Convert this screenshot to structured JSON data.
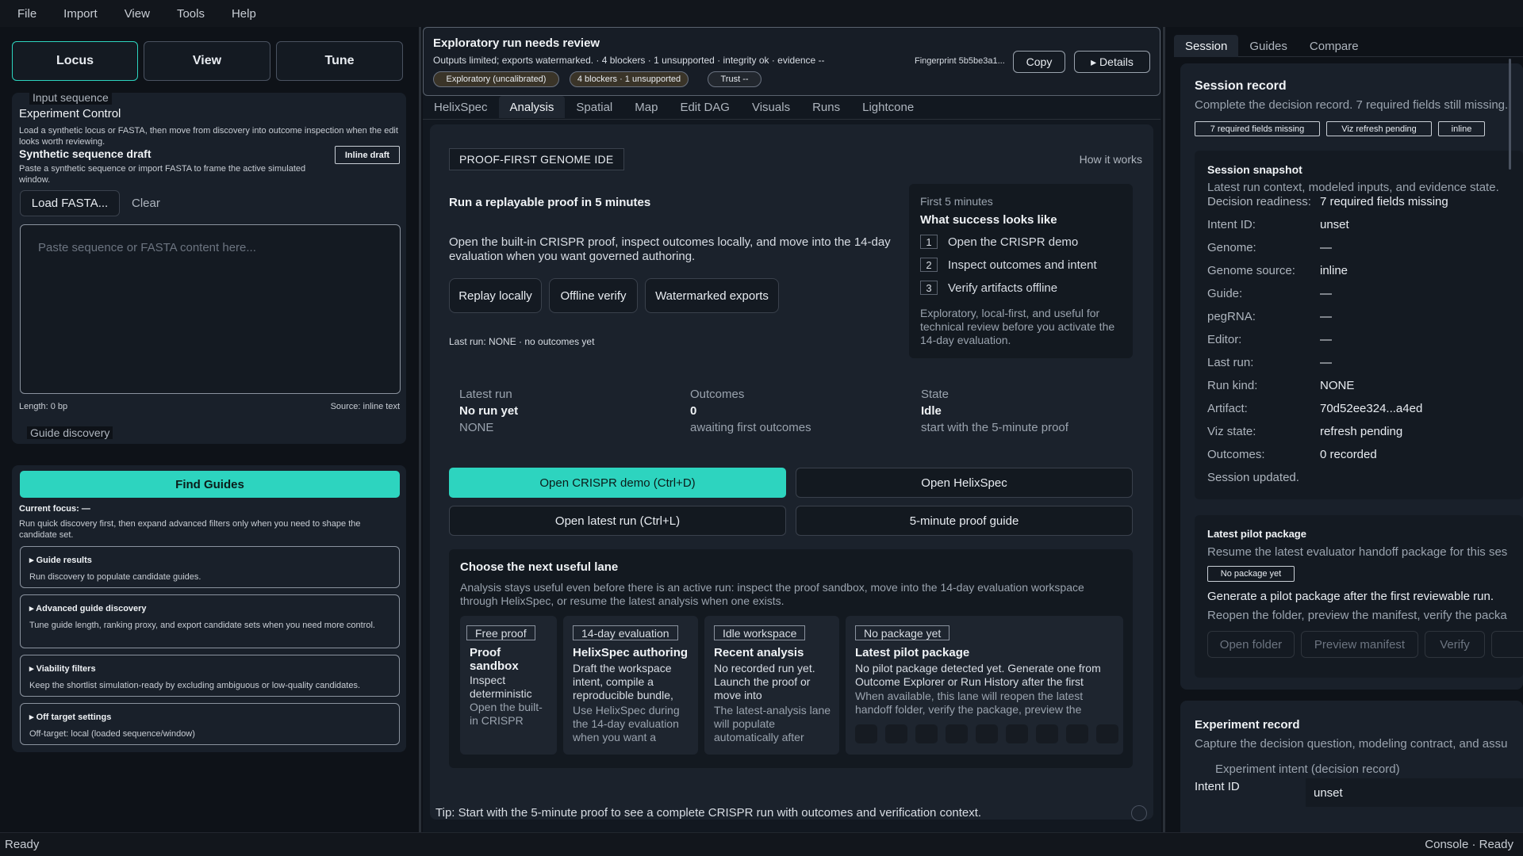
{
  "menu": [
    "File",
    "Import",
    "View",
    "Tools",
    "Help"
  ],
  "status": {
    "left": "Ready",
    "right": "Console · Ready"
  },
  "left": {
    "mode_tabs": [
      "Locus",
      "View",
      "Tune"
    ],
    "input_section_title": "Input sequence",
    "control_title": "Experiment Control",
    "control_desc": "Load a synthetic locus or FASTA, then move from discovery into outcome inspection when the edit looks worth reviewing.",
    "draft_title": "Synthetic sequence draft",
    "draft_badge": "Inline draft",
    "draft_desc": "Paste a synthetic sequence or import FASTA to frame the active simulated window.",
    "load_fasta": "Load FASTA...",
    "clear": "Clear",
    "seq_placeholder": "Paste sequence or FASTA content here...",
    "length": "Length: 0 bp",
    "source": "Source: inline text",
    "guide_section_title": "Guide discovery",
    "find_guides": "Find Guides",
    "current_focus": "Current focus: —",
    "discovery_desc": "Run quick discovery first, then expand advanced filters only when you need to shape the candidate set.",
    "sections": [
      {
        "title": "▸ Guide results",
        "desc": "Run discovery to populate candidate guides."
      },
      {
        "title": "▸ Advanced guide discovery",
        "desc": "Tune guide length, ranking proxy, and export candidate sets when you need more control."
      },
      {
        "title": "▸ Viability filters",
        "desc": "Keep the shortlist simulation-ready by excluding ambiguous or low-quality candidates."
      },
      {
        "title": "▸ Off target settings",
        "desc": "Off-target: local (loaded sequence/window)"
      }
    ]
  },
  "center": {
    "banner_title": "Exploratory run needs review",
    "banner_sub": "Outputs limited; exports watermarked. · 4 blockers · 1 unsupported · integrity ok · evidence --",
    "pills": [
      "Exploratory (uncalibrated)",
      "4 blockers · 1 unsupported",
      "Trust --"
    ],
    "fingerprint": "Fingerprint 5b5be3a1...",
    "copy": "Copy",
    "details": "▸ Details",
    "tabs": [
      "HelixSpec",
      "Analysis",
      "Spatial",
      "Map",
      "Edit DAG",
      "Visuals",
      "Runs",
      "Lightcone"
    ],
    "active_tab": "Analysis",
    "ide_label": "PROOF-FIRST GENOME IDE",
    "how_it_works": "How it works",
    "proof_title": "Run a replayable proof in 5 minutes",
    "proof_desc": "Open the built-in CRISPR proof, inspect outcomes locally, and move into the 14-day evaluation when you want governed authoring.",
    "proof_buttons": [
      "Replay locally",
      "Offline verify",
      "Watermarked exports"
    ],
    "last_run": "Last run: NONE · no outcomes yet",
    "first5": {
      "kicker": "First 5 minutes",
      "title": "What success looks like",
      "steps": [
        {
          "n": "1",
          "t": "Open the CRISPR demo"
        },
        {
          "n": "2",
          "t": "Inspect outcomes and intent"
        },
        {
          "n": "3",
          "t": "Verify artifacts offline"
        }
      ],
      "note": "Exploratory, local-first, and useful for technical review before you activate the 14-day evaluation."
    },
    "stats": [
      {
        "label": "Latest run",
        "value": "No run yet",
        "sub": "NONE"
      },
      {
        "label": "Outcomes",
        "value": "0",
        "sub": "awaiting first outcomes"
      },
      {
        "label": "State",
        "value": "Idle",
        "sub": "start with the 5-minute proof"
      }
    ],
    "actions": [
      "Open CRISPR demo (Ctrl+D)",
      "Open HelixSpec",
      "Open latest run (Ctrl+L)",
      "5-minute proof guide"
    ],
    "lane_title": "Choose the next useful lane",
    "lane_desc": "Analysis stays useful even before there is an active run: inspect the proof sandbox, move into the 14-day evaluation workspace through HelixSpec, or resume the latest analysis when one exists.",
    "lanes": [
      {
        "tag": "Free proof",
        "title": "Proof sandbox",
        "text": "Inspect deterministic outcomes",
        "more": "Open the built-in CRISPR"
      },
      {
        "tag": "14-day evaluation",
        "title": "HelixSpec authoring",
        "text": "Draft the workspace intent, compile a reproducible bundle,",
        "more": "Use HelixSpec during the 14-day evaluation when you want a"
      },
      {
        "tag": "Idle workspace",
        "title": "Recent analysis",
        "text": "No recorded run yet. Launch the proof or move into",
        "more": "The latest-analysis lane will populate automatically after"
      },
      {
        "tag": "No package yet",
        "title": "Latest pilot package",
        "text": "No pilot package detected yet. Generate one from Outcome Explorer or Run History after the first",
        "more": "When available, this lane will reopen the latest handoff folder, verify the package, preview the"
      }
    ],
    "tip": "Tip: Start with the 5-minute proof to see a complete CRISPR run with outcomes and verification context."
  },
  "right": {
    "tabs": [
      "Session",
      "Guides",
      "Compare"
    ],
    "record_title": "Session record",
    "record_desc": "Complete the decision record. 7 required fields still missing.",
    "chips": [
      "7 required fields missing",
      "Viz refresh pending",
      "inline"
    ],
    "snapshot_title": "Session snapshot",
    "snapshot_desc": "Latest run context, modeled inputs, and evidence state.",
    "kv": [
      {
        "k": "Decision readiness:",
        "v": "7 required fields missing"
      },
      {
        "k": "Intent ID:",
        "v": "unset"
      },
      {
        "k": "Genome:",
        "v": "—"
      },
      {
        "k": "Genome source:",
        "v": "inline"
      },
      {
        "k": "Guide:",
        "v": "—"
      },
      {
        "k": "pegRNA:",
        "v": "—"
      },
      {
        "k": "Editor:",
        "v": "—"
      },
      {
        "k": "Last run:",
        "v": "—"
      },
      {
        "k": "Run kind:",
        "v": "NONE"
      },
      {
        "k": "Artifact:",
        "v": "70d52ee324...a4ed"
      },
      {
        "k": "Viz state:",
        "v": "refresh pending"
      },
      {
        "k": "Outcomes:",
        "v": "0 recorded"
      }
    ],
    "session_updated": "Session updated.",
    "pilot_title": "Latest pilot package",
    "pilot_desc": "Resume the latest evaluator handoff package for this ses",
    "pilot_chip": "No package yet",
    "pilot_gen": "Generate a pilot package after the first reviewable run.",
    "pilot_reopen": "Reopen the folder, preview the manifest, verify the packa",
    "pilot_buttons": [
      "Open folder",
      "Preview manifest",
      "Verify"
    ],
    "exp_title": "Experiment record",
    "exp_desc": "Capture the decision question, modeling contract, and assu",
    "exp_sub": "Experiment intent (decision record)",
    "intent_label": "Intent ID",
    "intent_value": "unset"
  }
}
